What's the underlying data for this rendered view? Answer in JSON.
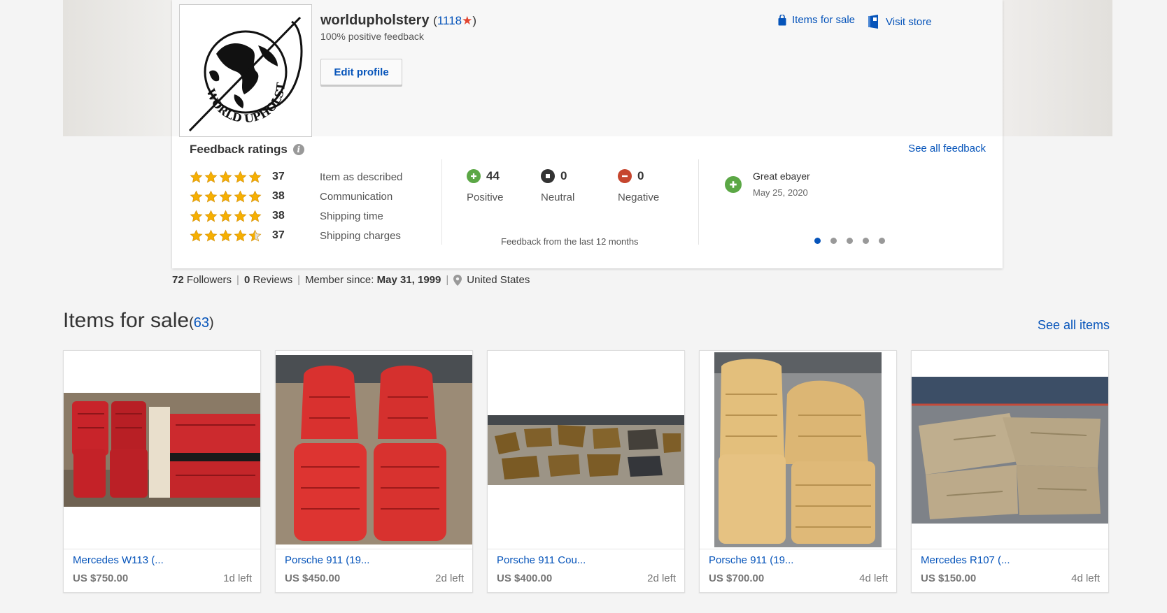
{
  "seller": {
    "name": "worldupholstery",
    "feedback_score_prefix": "(",
    "feedback_score": "1118",
    "feedback_score_star": "★",
    "feedback_score_suffix": ")",
    "positive_feedback": "100% positive feedback",
    "edit_profile": "Edit profile",
    "items_for_sale_link": "Items for sale",
    "visit_store_link": "Visit store",
    "logo_text": "WORLD UPHOLSTERY & TRIM"
  },
  "feedback": {
    "title": "Feedback ratings",
    "see_all": "See all feedback",
    "ratings": [
      {
        "stars": 5,
        "value": "37",
        "label": "Item as described"
      },
      {
        "stars": 5,
        "value": "38",
        "label": "Communication"
      },
      {
        "stars": 5,
        "value": "38",
        "label": "Shipping time"
      },
      {
        "stars": 4.5,
        "value": "37",
        "label": "Shipping charges"
      }
    ],
    "positive": {
      "count": "44",
      "label": "Positive",
      "color": "#5ba745"
    },
    "neutral": {
      "count": "0",
      "label": "Neutral",
      "color": "#333333"
    },
    "negative": {
      "count": "0",
      "label": "Negative",
      "color": "#c6462e"
    },
    "period": "Feedback from the last 12 months",
    "latest_comment": {
      "text": "Great ebayer",
      "date": "May 25, 2020"
    },
    "carousel_dots": 5,
    "carousel_active": 1
  },
  "member": {
    "followers_count": "72",
    "followers_label": "Followers",
    "reviews_count": "0",
    "reviews_label": "Reviews",
    "since_label": "Member since:",
    "since_date": "May 31, 1999",
    "location": "United States"
  },
  "items_section": {
    "title": "Items for sale",
    "count_prefix": "(",
    "count": "63",
    "count_suffix": ")",
    "see_all": "See all items"
  },
  "items": [
    {
      "title": "Mercedes W113 (...",
      "price": "US $750.00",
      "time_left": "1d left"
    },
    {
      "title": "Porsche 911 (19...",
      "price": "US $450.00",
      "time_left": "2d left"
    },
    {
      "title": "Porsche 911 Cou...",
      "price": "US $400.00",
      "time_left": "2d left"
    },
    {
      "title": "Porsche 911 (19...",
      "price": "US $700.00",
      "time_left": "4d left"
    },
    {
      "title": "Mercedes R107 (...",
      "price": "US $150.00",
      "time_left": "4d left"
    }
  ],
  "colors": {
    "link": "#0654ba",
    "star": "#f5af02",
    "accent_red": "#e2442f"
  }
}
